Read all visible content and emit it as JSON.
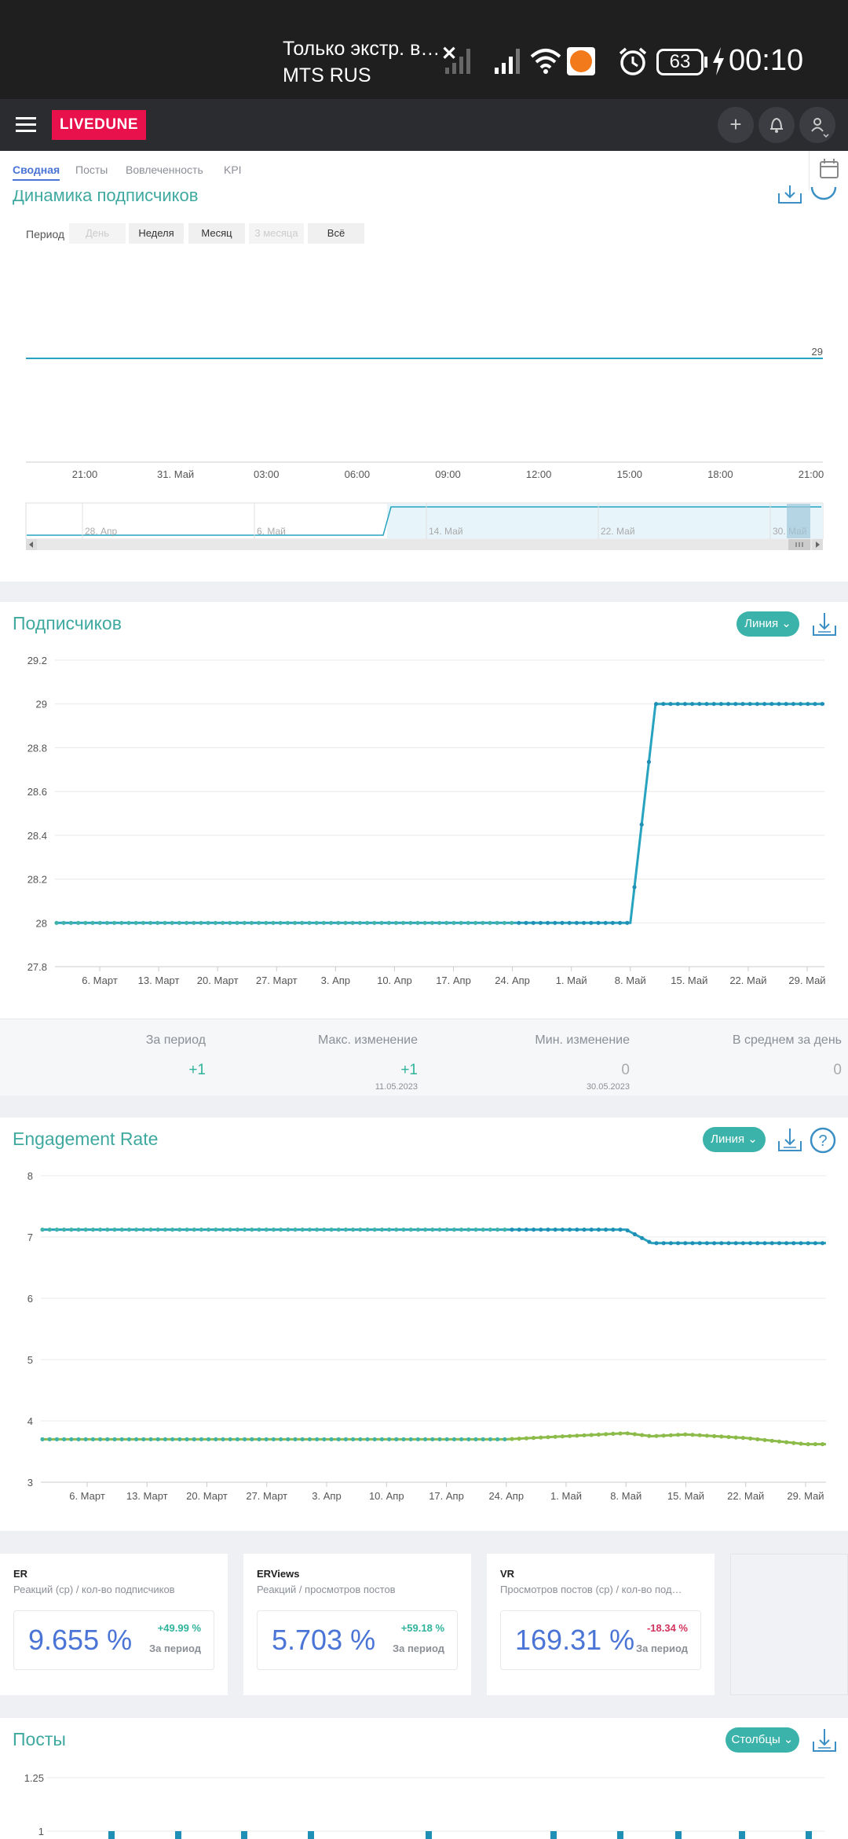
{
  "status_bar": {
    "notification": "Только экстр. в…",
    "carrier": "MTS RUS",
    "battery": "63",
    "time": "00:10"
  },
  "app": {
    "logo": "LIVEDUNE"
  },
  "tabs": [
    {
      "label": "Сводная",
      "active": true
    },
    {
      "label": "Посты"
    },
    {
      "label": "Вовлеченность"
    },
    {
      "label": "KPI"
    }
  ],
  "dynamics": {
    "title": "Динамика подписчиков",
    "period_label": "Период",
    "periods": [
      {
        "label": "День",
        "disabled": true
      },
      {
        "label": "Неделя"
      },
      {
        "label": "Месяц"
      },
      {
        "label": "3 месяца",
        "disabled": true
      },
      {
        "label": "Всё"
      }
    ],
    "value_label": "29",
    "x_ticks": [
      "21:00",
      "31. Май",
      "03:00",
      "06:00",
      "09:00",
      "12:00",
      "15:00",
      "18:00",
      "21:00"
    ],
    "navigator_ticks": [
      "28. Апр",
      "6. Май",
      "14. Май",
      "22. Май",
      "30. Май"
    ]
  },
  "subscribers": {
    "title": "Подписчиков",
    "mode": "Линия",
    "y_ticks": [
      "29.2",
      "29",
      "28.8",
      "28.6",
      "28.4",
      "28.2",
      "28",
      "27.8"
    ],
    "x_ticks": [
      "6. Март",
      "13. Март",
      "20. Март",
      "27. Март",
      "3. Апр",
      "10. Апр",
      "17. Апр",
      "24. Апр",
      "1. Май",
      "8. Май",
      "15. Май",
      "22. Май",
      "29. Май"
    ],
    "stats": [
      {
        "label": "За период",
        "value": "+1",
        "date": ""
      },
      {
        "label": "Макс. изменение",
        "value": "+1",
        "date": "11.05.2023"
      },
      {
        "label": "Мин. изменение",
        "value": "0",
        "date": "30.05.2023"
      },
      {
        "label": "В среднем за день",
        "value": "0",
        "date": ""
      }
    ]
  },
  "engagement": {
    "title": "Engagement Rate",
    "mode": "Линия",
    "y_ticks": [
      "8",
      "7",
      "6",
      "5",
      "4",
      "3"
    ],
    "x_ticks": [
      "6. Март",
      "13. Март",
      "20. Март",
      "27. Март",
      "3. Апр",
      "10. Апр",
      "17. Апр",
      "24. Апр",
      "1. Май",
      "8. Май",
      "15. Май",
      "22. Май",
      "29. Май"
    ]
  },
  "metrics": [
    {
      "title": "ER",
      "subtitle": "Реакций (ср) / кол-во подписчиков",
      "value": "9.655 %",
      "change": "+49.99 %",
      "change_color": "#2fb39a",
      "period": "За период"
    },
    {
      "title": "ERViews",
      "subtitle": "Реакций / просмотров постов",
      "value": "5.703 %",
      "change": "+59.18 %",
      "change_color": "#2fb39a",
      "period": "За период"
    },
    {
      "title": "VR",
      "subtitle": "Просмотров постов (ср) / кол-во под…",
      "value": "169.31 %",
      "change": "-18.34 %",
      "change_color": "#d2335c",
      "period": "За период"
    }
  ],
  "posts": {
    "title": "Посты",
    "mode": "Столбцы",
    "y_ticks": [
      "1.25",
      "1"
    ]
  },
  "colors": {
    "accent": "#3fa9a0",
    "teal_line": "#27a3c0",
    "green_line": "#8cbb4a",
    "logo_red": "#e8114b",
    "metric_value": "#4a74d6"
  },
  "chart_data": [
    {
      "type": "line",
      "title": "Динамика подписчиков",
      "x": [
        "21:00",
        "31. Май",
        "03:00",
        "06:00",
        "09:00",
        "12:00",
        "15:00",
        "18:00",
        "21:00"
      ],
      "series": [
        {
          "values": [
            29,
            29,
            29,
            29,
            29,
            29,
            29,
            29,
            29
          ]
        }
      ],
      "ylim": [
        29,
        29
      ]
    },
    {
      "type": "line",
      "title": "Подписчиков",
      "xlabel": "",
      "ylabel": "",
      "ylim": [
        27.8,
        29.2
      ],
      "x": [
        "6. Март",
        "13. Март",
        "20. Март",
        "27. Март",
        "3. Апр",
        "10. Апр",
        "17. Апр",
        "24. Апр",
        "1. Май",
        "8. Май",
        "11. Май",
        "15. Май",
        "22. Май",
        "29. Май"
      ],
      "series": [
        {
          "values": [
            28,
            28,
            28,
            28,
            28,
            28,
            28,
            28,
            28,
            28,
            29,
            29,
            29,
            29
          ]
        }
      ]
    },
    {
      "type": "line",
      "title": "Engagement Rate",
      "ylim": [
        3,
        8
      ],
      "x": [
        "6. Март",
        "13. Март",
        "20. Март",
        "27. Март",
        "3. Апр",
        "10. Апр",
        "17. Апр",
        "24. Апр",
        "1. Май",
        "8. Май",
        "11. Май",
        "15. Май",
        "22. Май",
        "29. Май"
      ],
      "series": [
        {
          "values": [
            7.12,
            7.12,
            7.12,
            7.12,
            7.12,
            7.12,
            7.12,
            7.12,
            7.12,
            7.12,
            6.9,
            6.9,
            6.9,
            6.9
          ]
        },
        {
          "values": [
            3.7,
            3.7,
            3.7,
            3.7,
            3.7,
            3.7,
            3.7,
            3.7,
            3.75,
            3.8,
            3.75,
            3.78,
            3.72,
            3.62
          ]
        }
      ]
    },
    {
      "type": "bar",
      "title": "Посты",
      "ylim": [
        1,
        1.25
      ],
      "series": [
        {
          "values": [
            1,
            1,
            1,
            1,
            1,
            1,
            1,
            1,
            1,
            1,
            1
          ]
        }
      ]
    }
  ]
}
